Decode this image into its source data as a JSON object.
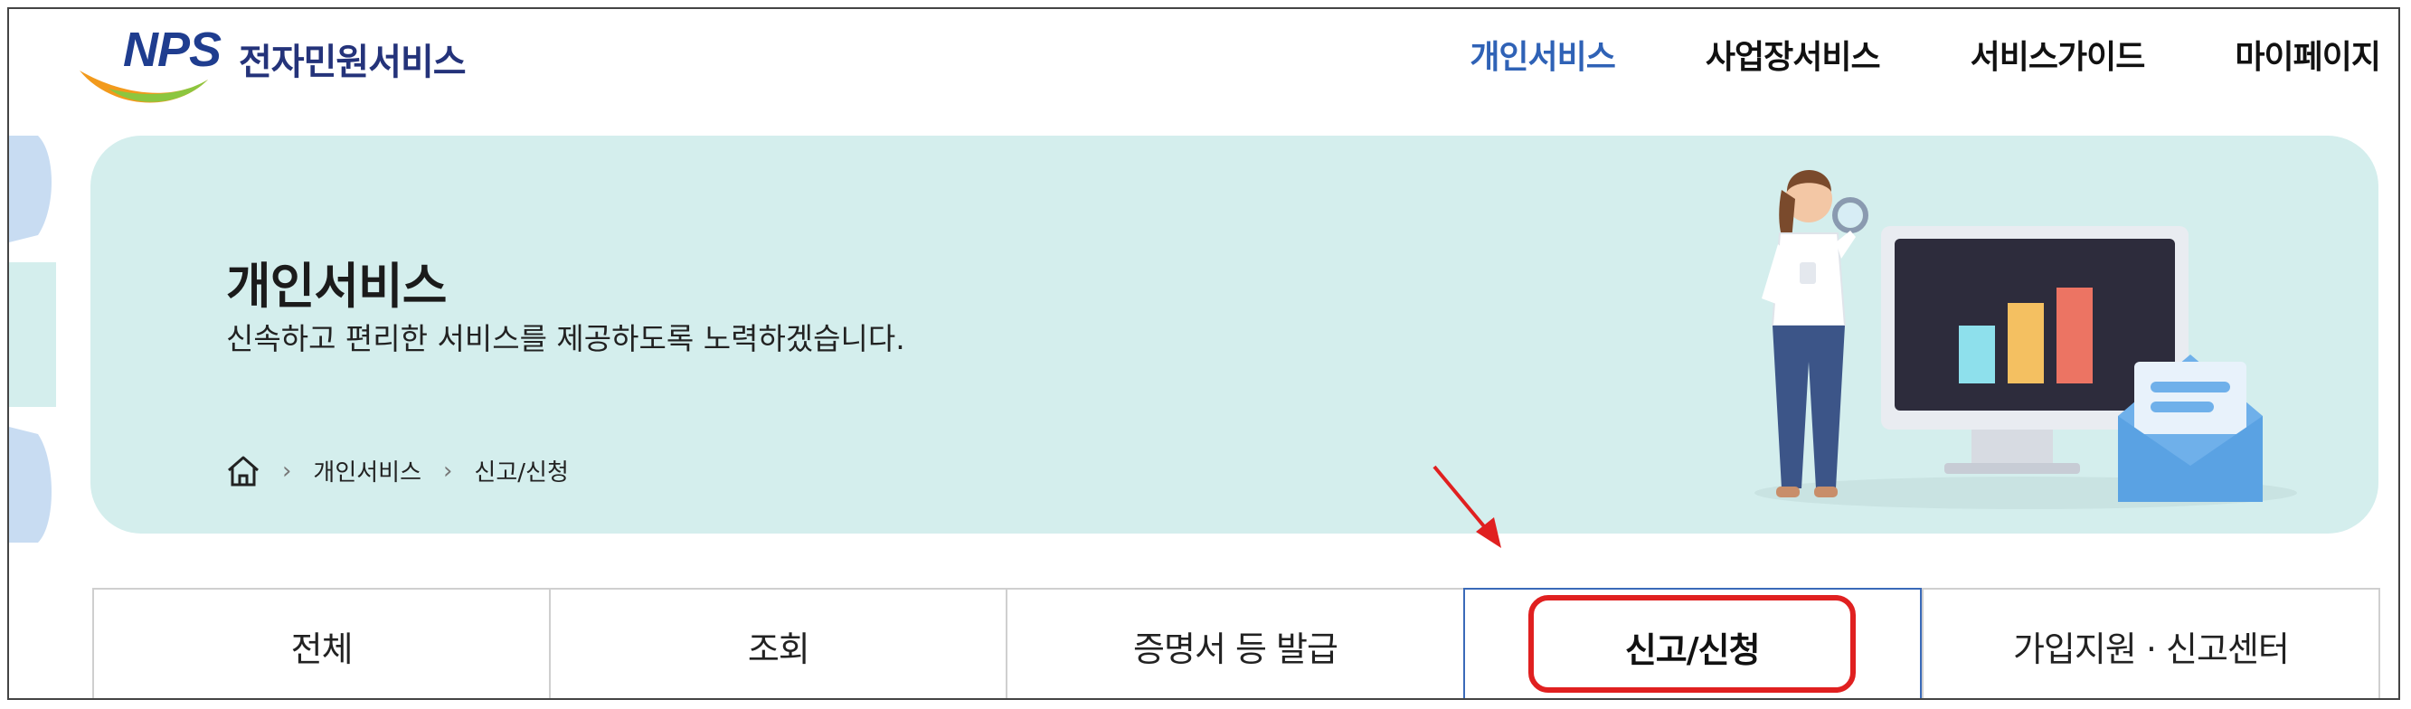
{
  "header": {
    "logo_mark": "NPS",
    "logo_text": "전자민원서비스",
    "nav": [
      {
        "label": "개인서비스",
        "active": true
      },
      {
        "label": "사업장서비스",
        "active": false
      },
      {
        "label": "서비스가이드",
        "active": false
      },
      {
        "label": "마이페이지",
        "active": false
      }
    ]
  },
  "banner": {
    "title": "개인서비스",
    "subtitle": "신속하고 편리한 서비스를 제공하도록 노력하겠습니다.",
    "breadcrumb": [
      "개인서비스",
      "신고/신청"
    ]
  },
  "tabs": [
    {
      "label": "전체"
    },
    {
      "label": "조회"
    },
    {
      "label": "증명서 등 발급"
    },
    {
      "label": "신고/신청",
      "selected": true
    },
    {
      "label": "가입지원 · 신고센터"
    }
  ],
  "colors": {
    "accent": "#2f62b6",
    "banner_bg": "#d4eeed",
    "highlight": "#e02020"
  },
  "icons": [
    "home-icon",
    "chevron-right-icon",
    "red-arrow-annotation"
  ]
}
